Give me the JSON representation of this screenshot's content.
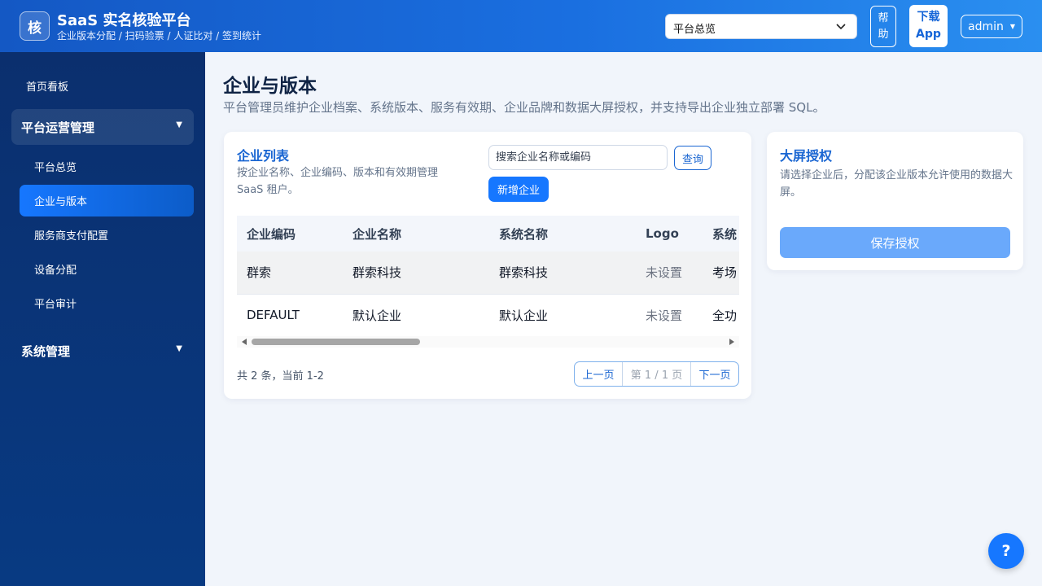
{
  "header": {
    "logo_char": "核",
    "title": "SaaS 实名核验平台",
    "subtitle": "企业版本分配 / 扫码验票 / 人证比对 / 签到统计",
    "platform_select": "平台总览",
    "help_label": "帮助",
    "download_label": "下载App",
    "user_label": "admin"
  },
  "sidebar": {
    "home": "首页看板",
    "group_platform": "平台运营管理",
    "items": [
      "平台总览",
      "企业与版本",
      "服务商支付配置",
      "设备分配",
      "平台审计"
    ],
    "active_index": 1,
    "group_system": "系统管理"
  },
  "page": {
    "title": "企业与版本",
    "description": "平台管理员维护企业档案、系统版本、服务有效期、企业品牌和数据大屏授权，并支持导出企业独立部署 SQL。"
  },
  "list_card": {
    "title": "企业列表",
    "description": "按企业名称、企业编码、版本和有效期管理 SaaS 租户。",
    "search_placeholder": "搜索企业名称或编码",
    "query_label": "查询",
    "add_label": "新增企业",
    "columns": [
      "企业编码",
      "企业名称",
      "系统名称",
      "Logo",
      "系统"
    ],
    "rows": [
      [
        "群索",
        "群索科技",
        "群索科技",
        "未设置",
        "考场"
      ],
      [
        "DEFAULT",
        "默认企业",
        "默认企业",
        "未设置",
        "全功"
      ]
    ],
    "total_text": "共 2 条，当前 1-2",
    "prev_label": "上一页",
    "page_info": "第 1 / 1 页",
    "next_label": "下一页"
  },
  "auth_card": {
    "title": "大屏授权",
    "description": "请选择企业后，分配该企业版本允许使用的数据大屏。",
    "save_label": "保存授权"
  },
  "float_help": "?"
}
